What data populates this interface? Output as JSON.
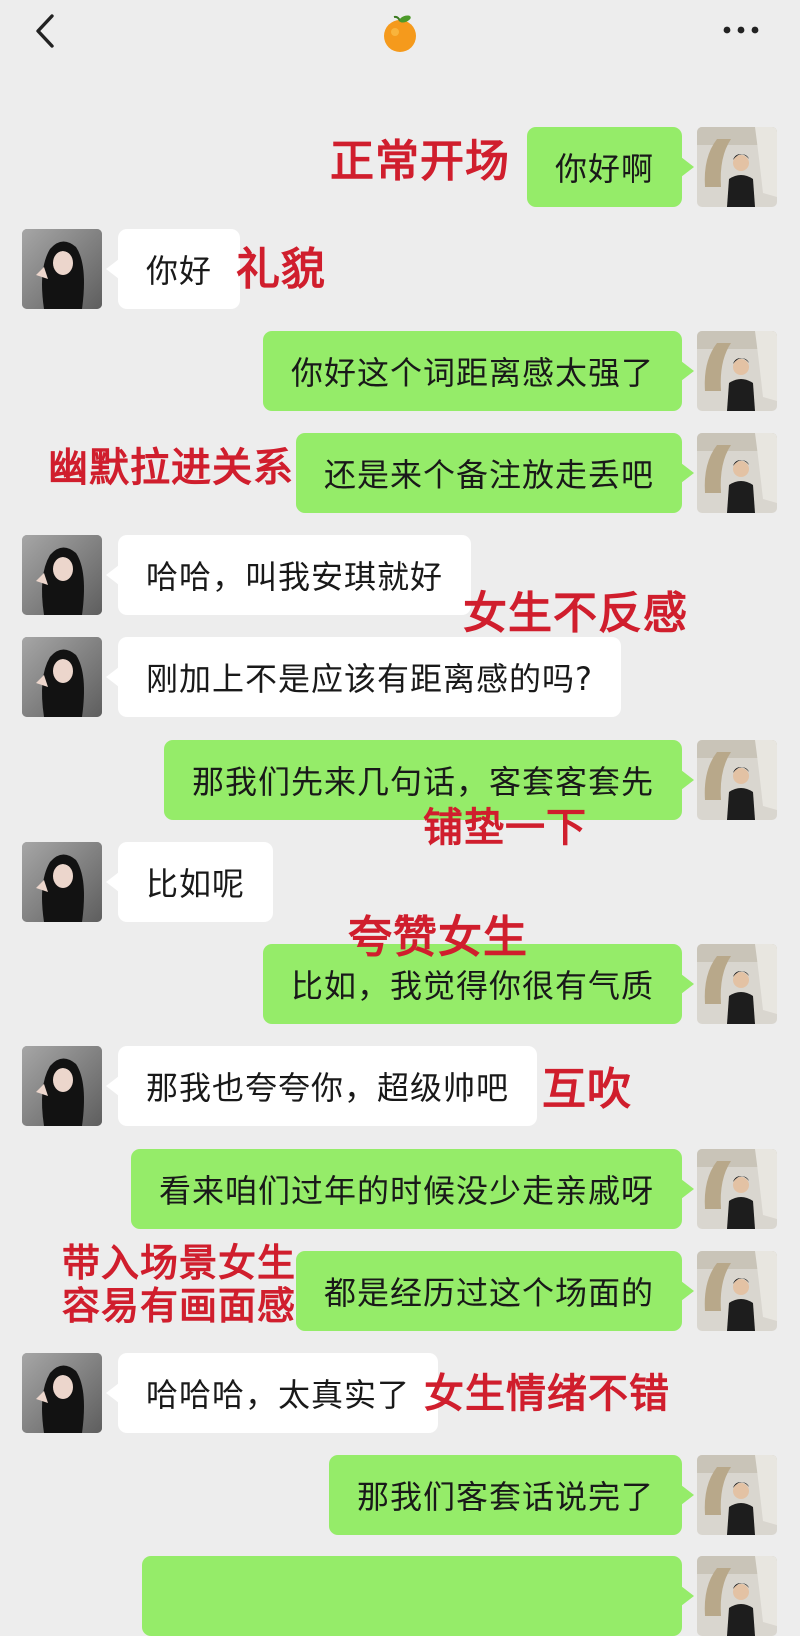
{
  "header": {
    "back_icon": "chevron-left-icon",
    "title_icon": "orange-icon",
    "more_icon": "ellipsis-icon"
  },
  "colors": {
    "background": "#ededed",
    "sent_bubble": "#95ec69",
    "received_bubble": "#ffffff",
    "annotation": "#d01e2d"
  },
  "messages": [
    {
      "from": "me",
      "text": "你好啊"
    },
    {
      "from": "her",
      "text": "你好"
    },
    {
      "from": "me",
      "text": "你好这个词距离感太强了"
    },
    {
      "from": "me",
      "text": "还是来个备注放走丢吧"
    },
    {
      "from": "her",
      "text": "哈哈，叫我安琪就好"
    },
    {
      "from": "her",
      "text": "刚加上不是应该有距离感的吗?"
    },
    {
      "from": "me",
      "text": "那我们先来几句话，客套客套先"
    },
    {
      "from": "her",
      "text": "比如呢"
    },
    {
      "from": "me",
      "text": "比如，我觉得你很有气质"
    },
    {
      "from": "her",
      "text": "那我也夸夸你，超级帅吧"
    },
    {
      "from": "me",
      "text": "看来咱们过年的时候没少走亲戚呀"
    },
    {
      "from": "me",
      "text": "都是经历过这个场面的"
    },
    {
      "from": "her",
      "text": "哈哈哈，太真实了"
    },
    {
      "from": "me",
      "text": "那我们客套话说完了"
    }
  ],
  "annotations": [
    "正常开场",
    "礼貌",
    "幽默拉进关系",
    "女生不反感",
    "铺垫一下",
    "夸赞女生",
    "互吹",
    "带入场景女生\n容易有画面感",
    "女生情绪不错"
  ]
}
